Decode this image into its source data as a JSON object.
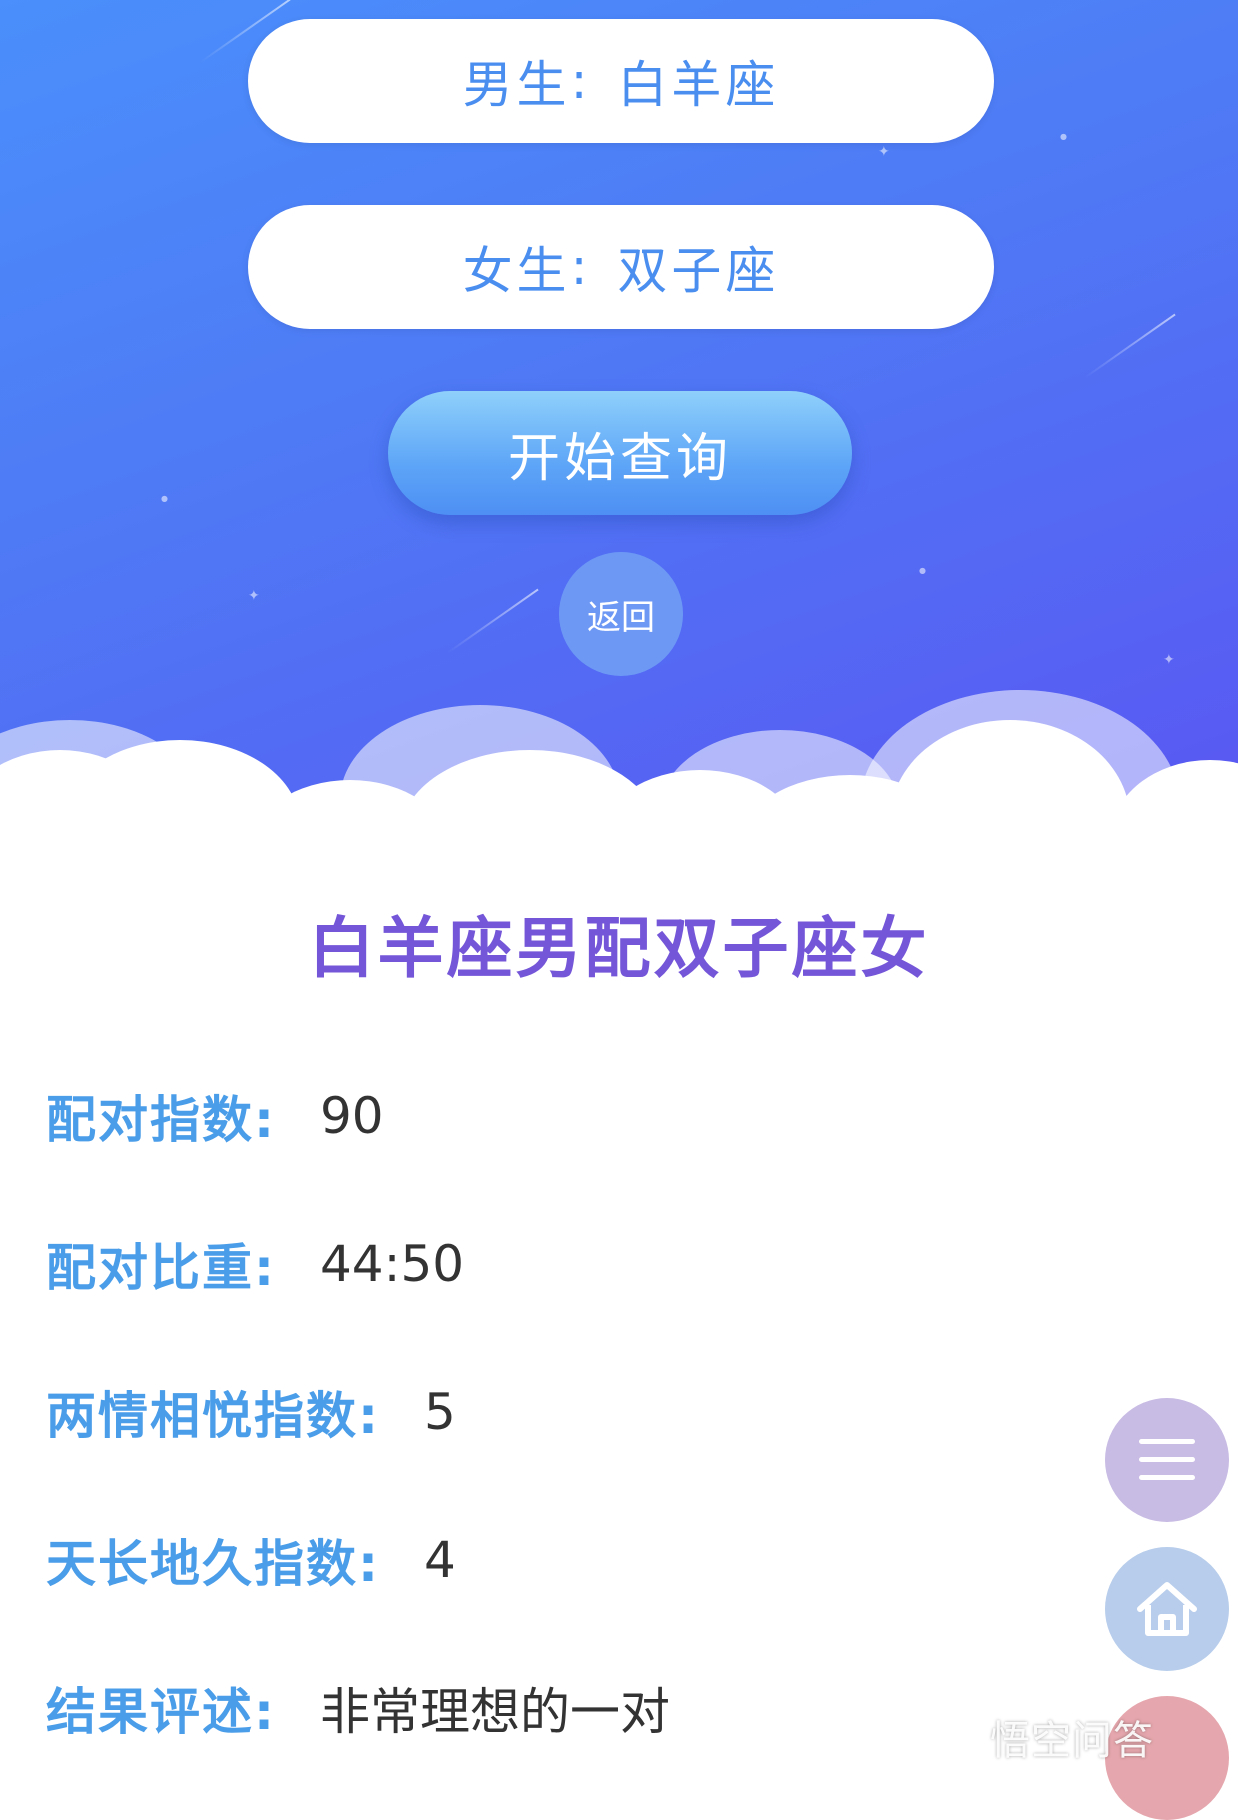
{
  "form": {
    "male_label": "男生",
    "male_value": "白羊座",
    "female_label": "女生",
    "female_value": "双子座",
    "separator": ":",
    "query_button": "开始查询",
    "back_button": "返回"
  },
  "result": {
    "title": "白羊座男配双子座女",
    "rows": [
      {
        "label": "配对指数:",
        "value": "90"
      },
      {
        "label": "配对比重:",
        "value": "44:50"
      },
      {
        "label": "两情相悦指数:",
        "value": "5"
      },
      {
        "label": "天长地久指数:",
        "value": "4"
      },
      {
        "label": "结果评述:",
        "value": "非常理想的一对"
      }
    ]
  },
  "floating": {
    "menu_icon": "hamburger-menu-icon",
    "home_icon": "home-icon"
  },
  "watermark": "悟空问答",
  "colors": {
    "hero_top": "#4a8ffb",
    "hero_bottom": "#5a55f2",
    "title": "#7456d8",
    "label": "#4a9de8",
    "value": "#333333",
    "pill_text": "#4a8ef0"
  }
}
